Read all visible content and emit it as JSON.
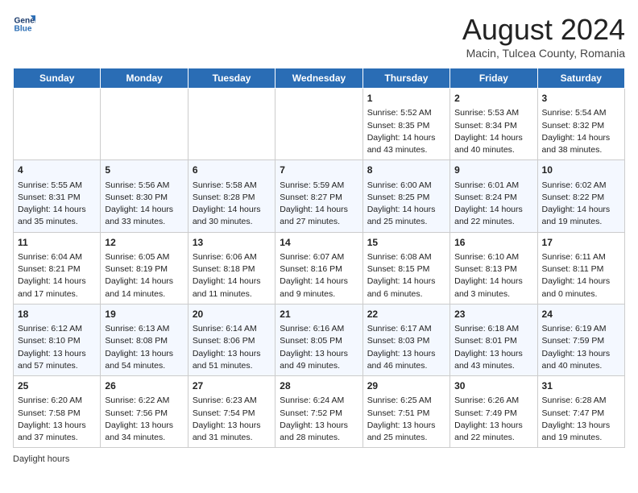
{
  "header": {
    "logo_line1": "General",
    "logo_line2": "Blue",
    "month_year": "August 2024",
    "location": "Macin, Tulcea County, Romania"
  },
  "days_of_week": [
    "Sunday",
    "Monday",
    "Tuesday",
    "Wednesday",
    "Thursday",
    "Friday",
    "Saturday"
  ],
  "weeks": [
    [
      {
        "day": "",
        "content": ""
      },
      {
        "day": "",
        "content": ""
      },
      {
        "day": "",
        "content": ""
      },
      {
        "day": "",
        "content": ""
      },
      {
        "day": "1",
        "content": "Sunrise: 5:52 AM\nSunset: 8:35 PM\nDaylight: 14 hours and 43 minutes."
      },
      {
        "day": "2",
        "content": "Sunrise: 5:53 AM\nSunset: 8:34 PM\nDaylight: 14 hours and 40 minutes."
      },
      {
        "day": "3",
        "content": "Sunrise: 5:54 AM\nSunset: 8:32 PM\nDaylight: 14 hours and 38 minutes."
      }
    ],
    [
      {
        "day": "4",
        "content": "Sunrise: 5:55 AM\nSunset: 8:31 PM\nDaylight: 14 hours and 35 minutes."
      },
      {
        "day": "5",
        "content": "Sunrise: 5:56 AM\nSunset: 8:30 PM\nDaylight: 14 hours and 33 minutes."
      },
      {
        "day": "6",
        "content": "Sunrise: 5:58 AM\nSunset: 8:28 PM\nDaylight: 14 hours and 30 minutes."
      },
      {
        "day": "7",
        "content": "Sunrise: 5:59 AM\nSunset: 8:27 PM\nDaylight: 14 hours and 27 minutes."
      },
      {
        "day": "8",
        "content": "Sunrise: 6:00 AM\nSunset: 8:25 PM\nDaylight: 14 hours and 25 minutes."
      },
      {
        "day": "9",
        "content": "Sunrise: 6:01 AM\nSunset: 8:24 PM\nDaylight: 14 hours and 22 minutes."
      },
      {
        "day": "10",
        "content": "Sunrise: 6:02 AM\nSunset: 8:22 PM\nDaylight: 14 hours and 19 minutes."
      }
    ],
    [
      {
        "day": "11",
        "content": "Sunrise: 6:04 AM\nSunset: 8:21 PM\nDaylight: 14 hours and 17 minutes."
      },
      {
        "day": "12",
        "content": "Sunrise: 6:05 AM\nSunset: 8:19 PM\nDaylight: 14 hours and 14 minutes."
      },
      {
        "day": "13",
        "content": "Sunrise: 6:06 AM\nSunset: 8:18 PM\nDaylight: 14 hours and 11 minutes."
      },
      {
        "day": "14",
        "content": "Sunrise: 6:07 AM\nSunset: 8:16 PM\nDaylight: 14 hours and 9 minutes."
      },
      {
        "day": "15",
        "content": "Sunrise: 6:08 AM\nSunset: 8:15 PM\nDaylight: 14 hours and 6 minutes."
      },
      {
        "day": "16",
        "content": "Sunrise: 6:10 AM\nSunset: 8:13 PM\nDaylight: 14 hours and 3 minutes."
      },
      {
        "day": "17",
        "content": "Sunrise: 6:11 AM\nSunset: 8:11 PM\nDaylight: 14 hours and 0 minutes."
      }
    ],
    [
      {
        "day": "18",
        "content": "Sunrise: 6:12 AM\nSunset: 8:10 PM\nDaylight: 13 hours and 57 minutes."
      },
      {
        "day": "19",
        "content": "Sunrise: 6:13 AM\nSunset: 8:08 PM\nDaylight: 13 hours and 54 minutes."
      },
      {
        "day": "20",
        "content": "Sunrise: 6:14 AM\nSunset: 8:06 PM\nDaylight: 13 hours and 51 minutes."
      },
      {
        "day": "21",
        "content": "Sunrise: 6:16 AM\nSunset: 8:05 PM\nDaylight: 13 hours and 49 minutes."
      },
      {
        "day": "22",
        "content": "Sunrise: 6:17 AM\nSunset: 8:03 PM\nDaylight: 13 hours and 46 minutes."
      },
      {
        "day": "23",
        "content": "Sunrise: 6:18 AM\nSunset: 8:01 PM\nDaylight: 13 hours and 43 minutes."
      },
      {
        "day": "24",
        "content": "Sunrise: 6:19 AM\nSunset: 7:59 PM\nDaylight: 13 hours and 40 minutes."
      }
    ],
    [
      {
        "day": "25",
        "content": "Sunrise: 6:20 AM\nSunset: 7:58 PM\nDaylight: 13 hours and 37 minutes."
      },
      {
        "day": "26",
        "content": "Sunrise: 6:22 AM\nSunset: 7:56 PM\nDaylight: 13 hours and 34 minutes."
      },
      {
        "day": "27",
        "content": "Sunrise: 6:23 AM\nSunset: 7:54 PM\nDaylight: 13 hours and 31 minutes."
      },
      {
        "day": "28",
        "content": "Sunrise: 6:24 AM\nSunset: 7:52 PM\nDaylight: 13 hours and 28 minutes."
      },
      {
        "day": "29",
        "content": "Sunrise: 6:25 AM\nSunset: 7:51 PM\nDaylight: 13 hours and 25 minutes."
      },
      {
        "day": "30",
        "content": "Sunrise: 6:26 AM\nSunset: 7:49 PM\nDaylight: 13 hours and 22 minutes."
      },
      {
        "day": "31",
        "content": "Sunrise: 6:28 AM\nSunset: 7:47 PM\nDaylight: 13 hours and 19 minutes."
      }
    ]
  ],
  "footer": {
    "label": "Daylight hours"
  }
}
